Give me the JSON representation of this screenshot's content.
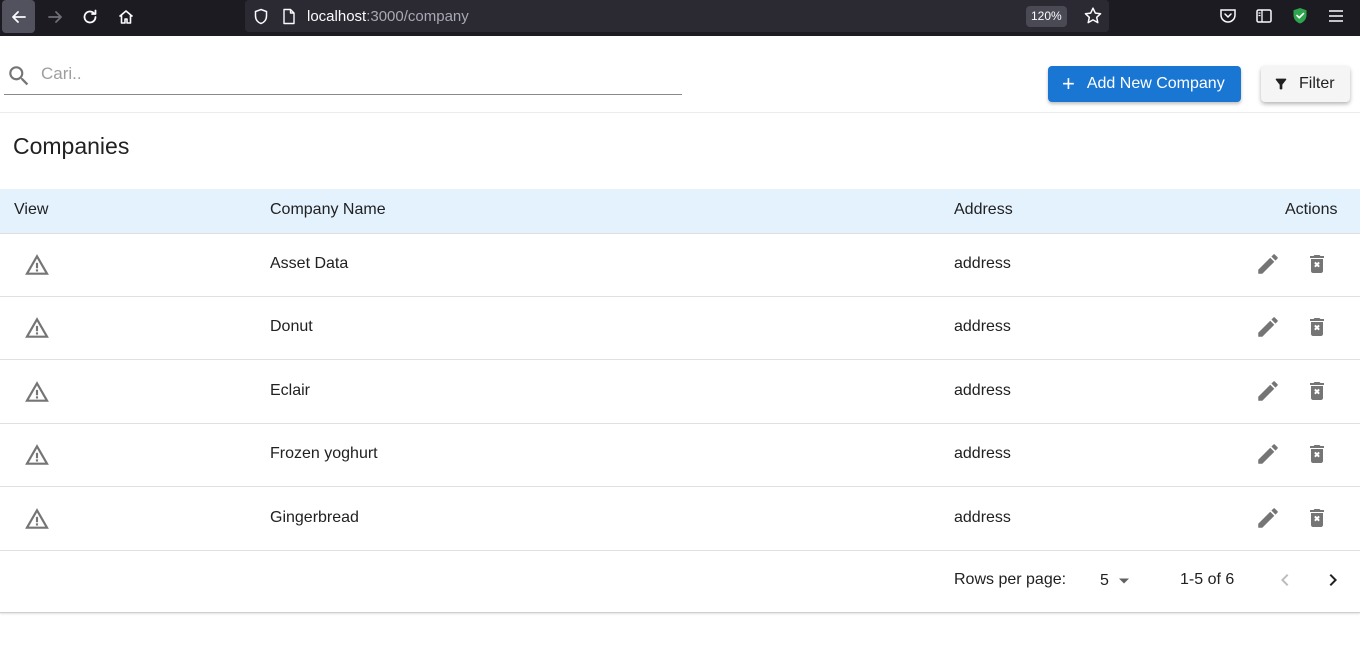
{
  "browser": {
    "url_host": "localhost",
    "url_path": ":3000/company",
    "zoom": "120%"
  },
  "search": {
    "placeholder": "Cari.."
  },
  "toolbar": {
    "add_label": "Add New Company",
    "filter_label": "Filter",
    "accent": "#1976d2"
  },
  "page": {
    "title": "Companies"
  },
  "table": {
    "columns": {
      "view": "View",
      "company_name": "Company Name",
      "address": "Address",
      "actions": "Actions"
    },
    "header_bg": "#e3f2fd",
    "rows": [
      {
        "name": "Asset Data",
        "address": "address"
      },
      {
        "name": "Donut",
        "address": "address"
      },
      {
        "name": "Eclair",
        "address": "address"
      },
      {
        "name": "Frozen yoghurt",
        "address": "address"
      },
      {
        "name": "Gingerbread",
        "address": "address"
      }
    ],
    "icons": {
      "view": "warning-triangle-icon",
      "edit": "pencil-icon",
      "delete": "delete-icon"
    }
  },
  "pagination": {
    "rows_per_page_label": "Rows per page:",
    "rows_per_page": "5",
    "range": "1-5 of 6"
  }
}
